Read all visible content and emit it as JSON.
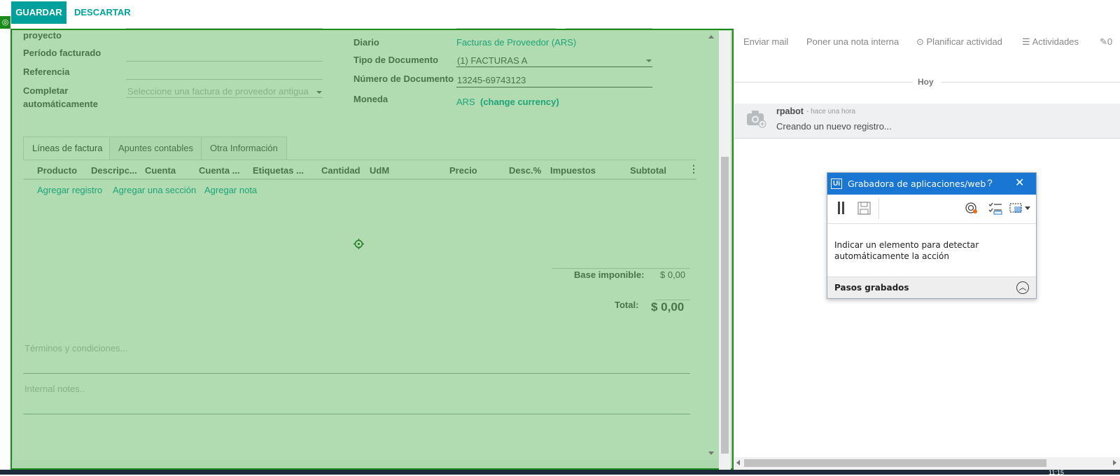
{
  "toolbar": {
    "save_label": "GUARDAR",
    "discard_label": "DESCARTAR"
  },
  "form": {
    "proyecto_label": "proyecto",
    "periodo_label": "Período facturado",
    "referencia_label": "Referencia",
    "completar_label_1": "Completar",
    "completar_label_2": "automáticamente",
    "completar_placeholder": "Seleccione una factura de proveedor antigua",
    "diario_label": "Diario",
    "diario_value": "Facturas de Proveedor (ARS)",
    "tipo_doc_label": "Tipo de Documento",
    "tipo_doc_value": "(1) FACTURAS A",
    "num_doc_label": "Número de Documento",
    "num_doc_value": "13245-69743123",
    "moneda_label": "Moneda",
    "moneda_value": "ARS",
    "change_currency": "(change currency)"
  },
  "tabs": [
    "Líneas de factura",
    "Apuntes contables",
    "Otra Información"
  ],
  "table": {
    "headers": [
      "Producto",
      "Descripc...",
      "Cuenta",
      "Cuenta ...",
      "Etiquetas ...",
      "Cantidad",
      "UdM",
      "Precio",
      "Desc.%",
      "Impuestos",
      "Subtotal"
    ],
    "add_record": "Agregar registro",
    "add_section": "Agregar una sección",
    "add_note": "Agregar nota"
  },
  "totals": {
    "base_label": "Base imponible:",
    "base_value": "$ 0,00",
    "total_label": "Total:",
    "total_value": "$ 0,00"
  },
  "notes": {
    "terms_placeholder": "Términos y condiciones...",
    "internal_placeholder": "Internal notes.."
  },
  "chatter": {
    "send_mail": "Enviar mail",
    "log_note": "Poner una nota interna",
    "schedule": "Planificar actividad",
    "activities": "Actividades",
    "attachments_count": "0",
    "date_separator": "Hoy",
    "author": "rpabot",
    "time": "- hace una hora",
    "message": "Creando un nuevo registro..."
  },
  "recorder": {
    "logo": "Ui",
    "title": "Grabadora de aplicaciones/web",
    "help": "?",
    "body": "Indicar un elemento para detectar automáticamente la acción",
    "steps_label": "Pasos grabados"
  },
  "taskbar": {
    "clock": "11:15"
  },
  "colors": {
    "accent": "#00a09d",
    "highlight": "#46aa46",
    "recorder_blue": "#1976d2"
  }
}
